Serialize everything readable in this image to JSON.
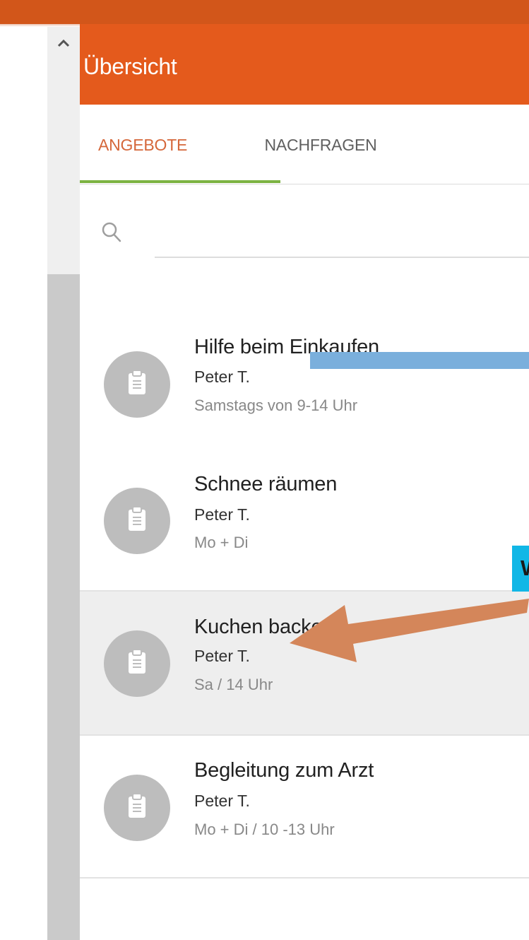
{
  "header": {
    "title": "Übersicht",
    "color": "#e45a1c"
  },
  "tabs": [
    {
      "label": "ANGEBOTE",
      "active": true
    },
    {
      "label": "NACHFRAGEN",
      "active": false
    }
  ],
  "search": {
    "icon": "search-icon",
    "value": "",
    "placeholder": ""
  },
  "list": [
    {
      "title": "Hilfe beim Einkaufen",
      "name": "Peter T.",
      "time": "Samstags von 9-14 Uhr",
      "icon": "clipboard-icon",
      "highlighted": false
    },
    {
      "title": "Schnee räumen",
      "name": "Peter T.",
      "time": "Mo + Di",
      "icon": "clipboard-icon",
      "highlighted": false
    },
    {
      "title": "Kuchen backen",
      "name": "Peter T.",
      "time": "Sa / 14 Uhr",
      "icon": "clipboard-icon",
      "highlighted": true
    },
    {
      "title": "Begleitung zum Arzt",
      "name": "Peter T.",
      "time": "Mo + Di / 10 -13 Uhr",
      "icon": "clipboard-icon",
      "highlighted": false
    }
  ],
  "callout": {
    "text": "W",
    "color": "#11b7e6"
  },
  "annotation_arrow": {
    "color": "#d4865a"
  },
  "colors": {
    "accent": "#e45a1c",
    "tab_active": "#d5673a",
    "tab_indicator": "#7cb342",
    "redaction": "#7aafdc"
  }
}
